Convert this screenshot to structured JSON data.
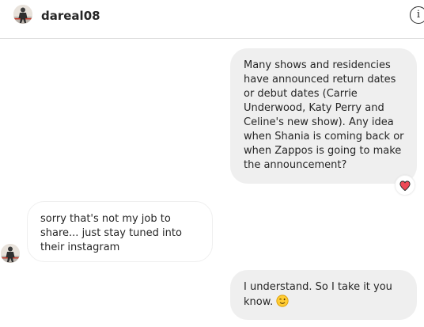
{
  "header": {
    "username": "dareal08",
    "info_glyph": "i",
    "avatar_icon": "profile-avatar",
    "info_icon": "info-icon"
  },
  "messages": [
    {
      "direction": "outgoing",
      "text": "Many shows and residencies have announced return dates or debut dates (Carrie Underwood, Katy Perry and Celine's new show). Any idea when Shania is coming back or when Zappos is going to make the announcement?",
      "reaction": "heart-icon",
      "reaction_color": "#ed4956"
    },
    {
      "direction": "incoming",
      "text": "sorry that's not my job to share... just stay tuned into their instagram",
      "sender_avatar": "profile-avatar"
    },
    {
      "direction": "outgoing",
      "text": "I understand. So I take it you know.",
      "emoji": "winking-face-icon"
    }
  ],
  "colors": {
    "outgoing_bubble": "#efefef",
    "incoming_border": "#efefef",
    "text": "#262626",
    "divider": "#dbdbdb"
  }
}
